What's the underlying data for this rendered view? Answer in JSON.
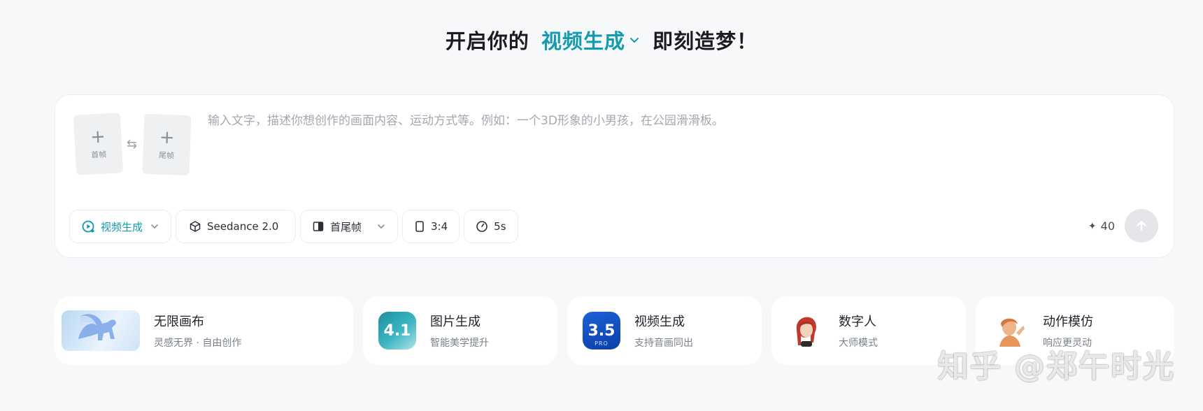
{
  "headline": {
    "prefix": "开启你的",
    "mode": "视频生成",
    "suffix": "即刻造梦！"
  },
  "prompt": {
    "placeholder": "输入文字，描述你想创作的画面内容、运动方式等。例如：一个3D形象的小男孩，在公园滑滑板。",
    "value": "",
    "first_frame_label": "首帧",
    "last_frame_label": "尾帧"
  },
  "toolbar": {
    "mode_label": "视频生成",
    "model_label": "Seedance 2.0",
    "frames_label": "首尾帧",
    "ratio_label": "3:4",
    "duration_label": "5s"
  },
  "credits": {
    "value": "40"
  },
  "features": [
    {
      "title": "无限画布",
      "subtitle": "灵感无界 · 自由创作",
      "icon": "pegasus-image"
    },
    {
      "title": "图片生成",
      "subtitle": "智能美学提升",
      "icon": "image-model-4.1",
      "badge": "4.1"
    },
    {
      "title": "视频生成",
      "subtitle": "支持音画同出",
      "icon": "video-model-3.5-pro",
      "badge": "3.5",
      "badge_sub": "PRO"
    },
    {
      "title": "数字人",
      "subtitle": "大师模式",
      "icon": "digital-human-avatar"
    },
    {
      "title": "动作模仿",
      "subtitle": "响应更灵动",
      "icon": "motion-avatar"
    }
  ],
  "watermark": "知乎 @郑午时光",
  "colors": {
    "accent": "#139bb0",
    "background": "#f7f8fa"
  }
}
